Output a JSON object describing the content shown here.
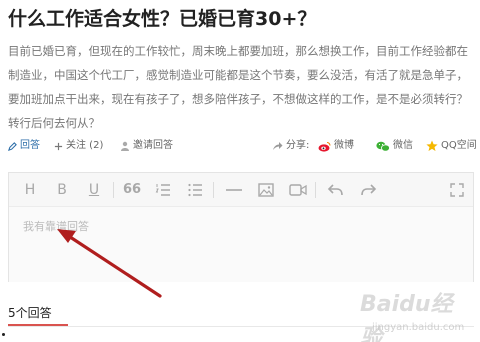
{
  "question": {
    "title": "什么工作适合女性？已婚已育30+？",
    "description": "目前已婚已育，但现在的工作较忙，周末晚上都要加班，那么想换工作，目前工作经验都在制造业，中国这个代工厂，感觉制造业可能都是这个节奏，要么没活，有活了就是急单子，要加班加点干出来，现在有孩子了，想多陪伴孩子，不想做这样的工作，是不是必须转行？转行后何去何从？"
  },
  "actions": {
    "answer_label": "回答",
    "follow_label": "关注 (2)",
    "invite_label": "邀请回答",
    "share_label": "分享:",
    "weibo_label": "微博",
    "wechat_label": "微信",
    "qq_label": "QQ空间"
  },
  "editor": {
    "toolbar": {
      "heading": "H",
      "bold": "B",
      "underline": "U",
      "quote": "66"
    },
    "placeholder": "我有靠谱回答"
  },
  "answers": {
    "count_label": "5个回答"
  },
  "watermark": {
    "logo": "Baidu经验",
    "url": "jingyan.baidu.com"
  },
  "colors": {
    "link_blue": "#2d6ea8",
    "weibo_red": "#e6162d",
    "wechat_green": "#3cb034",
    "qq_yellow": "#f5b800",
    "arrow_red": "#b01e1e",
    "tab_underline": "#d9534f"
  }
}
